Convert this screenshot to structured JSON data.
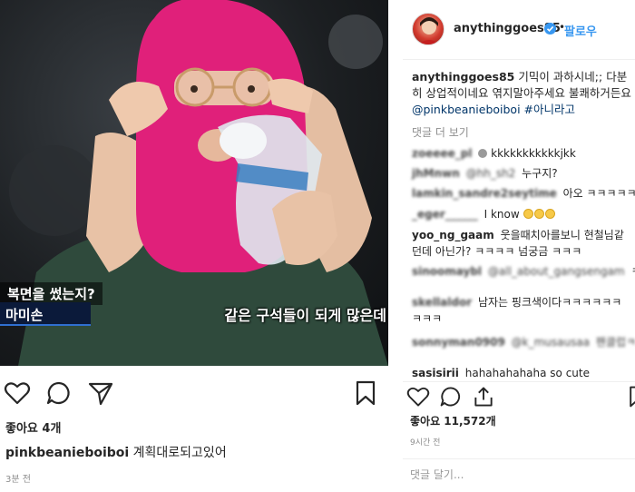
{
  "left_post": {
    "photo_caption_top": "복면을 썼는지?",
    "photo_caption_name": "마미손",
    "photo_caption_subtitle": "같은 구석들이 되게 많은데",
    "likes": "좋아요 4개",
    "caption_user": "pinkbeanieboiboi",
    "caption_text": "계획대로되고있어",
    "time": "3분 전",
    "icons": [
      "heart-icon",
      "comment-icon",
      "share-icon",
      "bookmark-icon"
    ]
  },
  "right_post": {
    "header_user": "anythinggoes85",
    "follow_dot": "•",
    "follow": "팔로우",
    "post_user": "anythinggoes85",
    "post_text": "기믹이 과하시네;; 다분히 상업적이네요 엮지말아주세요 불쾌하거든요",
    "post_mention": "@pinkbeanieboiboi",
    "post_hashtag": "#아니라고",
    "more_comments": "댓글 더 보기",
    "comments": [
      {
        "user": "zoeeee_pl",
        "text": "kkkkkkkkkkkjkk"
      },
      {
        "user": "jhMnwn",
        "mention": "@hh_sh2",
        "text": "누구지?"
      },
      {
        "user": "lamkin_sandre2seytime",
        "text": "아오 ㅋㅋㅋㅋㅋ"
      },
      {
        "user": "_eger______",
        "text": "I know"
      },
      {
        "user": "yoo_ng_gaam",
        "text": "웃을때치아를보니 현철님같던데 아닌가? ㅋㅋㅋㅋ 넘궁금 ㅋㅋㅋ"
      },
      {
        "user": "sinoomaybl",
        "mention": "@all_about_gangsengam",
        "text": "ㅋㅋ"
      },
      {
        "user": "skellaldor",
        "text": "남자는 핑크색이다ㅋㅋㅋㅋㅋㅋ ㅋㅋㅋ"
      },
      {
        "user": "sonnyman0909",
        "mention": "@k_musausaa",
        "text": "팬클럽ㅋ..."
      },
      {
        "user": "sasisirii",
        "text": "hahahahahaha so cute"
      }
    ],
    "likes": "좋아요 11,572개",
    "time": "9시간 전",
    "comment_placeholder": "댓글 달기...",
    "icons": [
      "heart-icon",
      "comment-icon",
      "share-icon",
      "bookmark-icon",
      "verified-icon"
    ],
    "colors": {
      "link": "#003569",
      "follow": "#3897f0",
      "muted": "#8e8e8e"
    }
  }
}
